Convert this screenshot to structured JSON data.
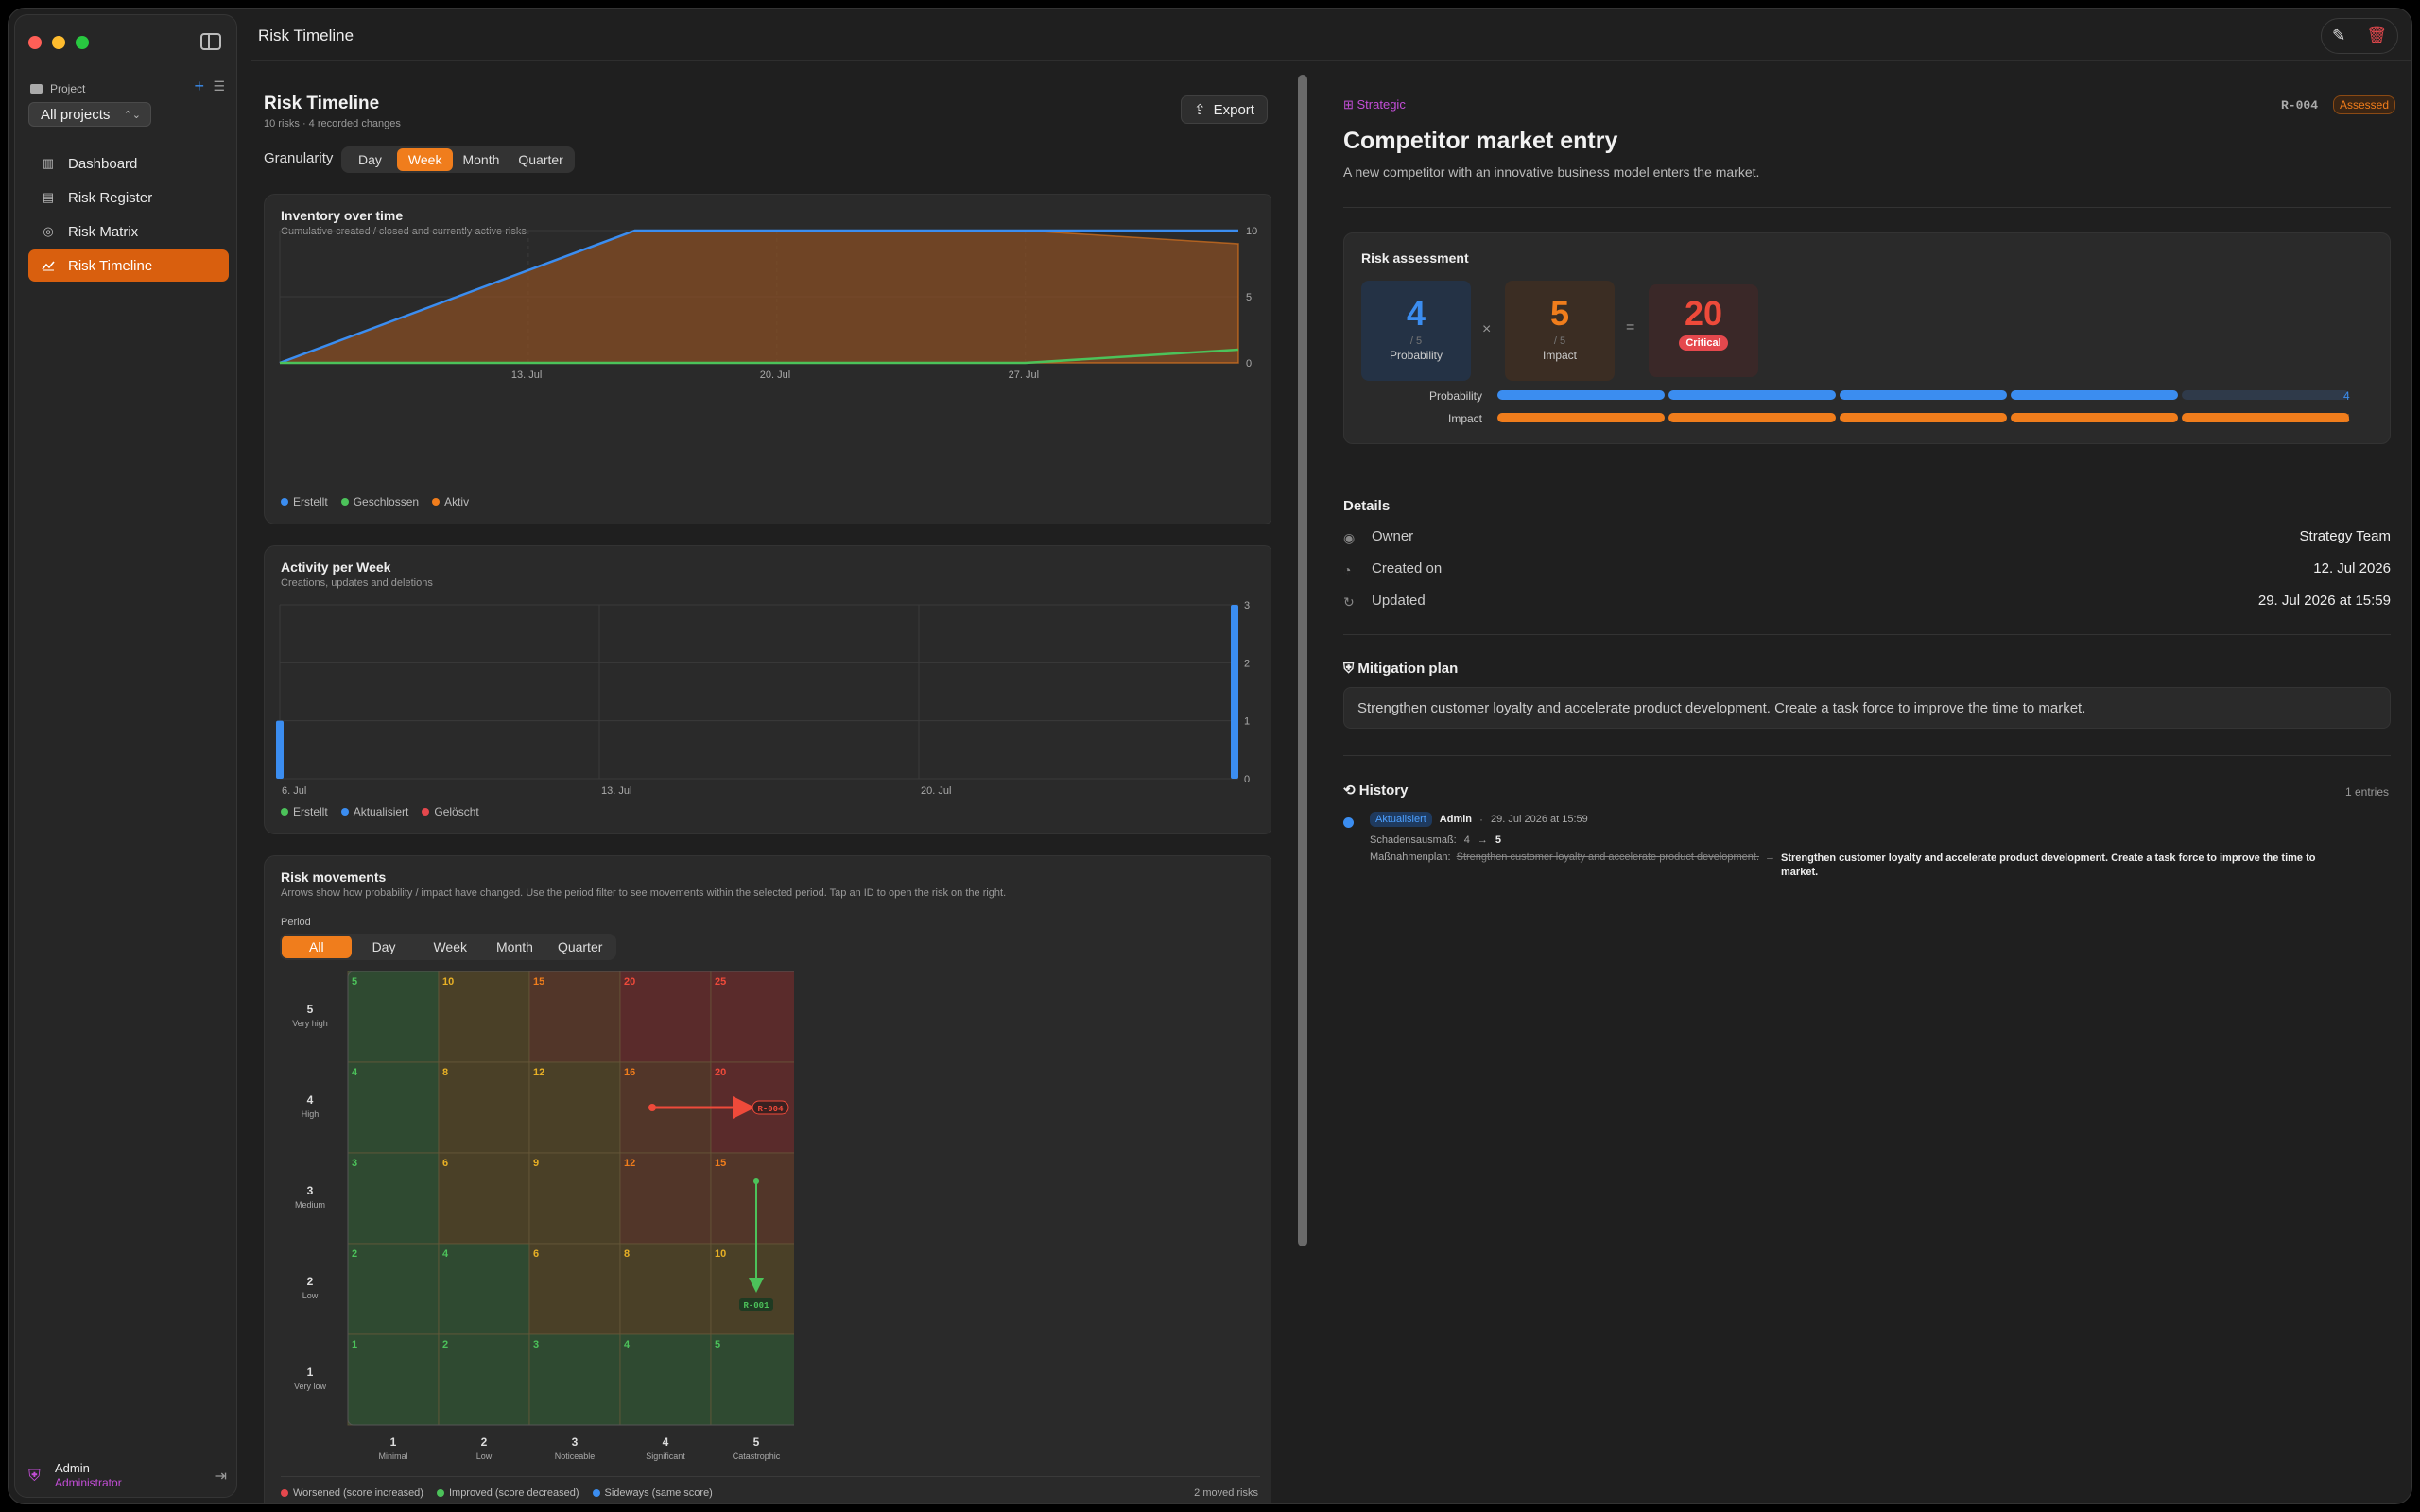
{
  "window": {
    "title": "Risk Timeline"
  },
  "sidebar": {
    "project_label": "Project",
    "project_select": "All projects",
    "items": [
      {
        "label": "Dashboard",
        "icon": "chart-bars-icon",
        "active": false
      },
      {
        "label": "Risk Register",
        "icon": "clipboard-icon",
        "active": false
      },
      {
        "label": "Risk Matrix",
        "icon": "target-icon",
        "active": false
      },
      {
        "label": "Risk Timeline",
        "icon": "line-chart-icon",
        "active": true
      }
    ],
    "user": {
      "name": "Admin",
      "role": "Administrator"
    }
  },
  "main": {
    "title": "Risk Timeline",
    "subtitle": "10 risks · 4 recorded changes",
    "export_label": "Export",
    "granularity_label": "Granularity",
    "granularity": [
      "Day",
      "Week",
      "Month",
      "Quarter"
    ],
    "granularity_selected": "Week"
  },
  "inventory": {
    "title": "Inventory over time",
    "subtitle": "Cumulative created / closed and currently active risks",
    "legend": [
      "Erstellt",
      "Geschlossen",
      "Aktiv"
    ]
  },
  "activity": {
    "title": "Activity per Week",
    "subtitle": "Creations, updates and deletions",
    "legend": [
      "Erstellt",
      "Aktualisiert",
      "Gelöscht"
    ]
  },
  "chart_data": [
    {
      "type": "area",
      "title": "Inventory over time",
      "x_ticks": [
        "13. Jul",
        "20. Jul",
        "27. Jul"
      ],
      "y_ticks": [
        0,
        5,
        10
      ],
      "ylim": [
        0,
        10
      ],
      "series": [
        {
          "name": "Erstellt",
          "color": "#3b8df0",
          "points": [
            [
              "06. Jul",
              0
            ],
            [
              "13. Jul",
              4.6
            ],
            [
              "13. Jul+3d",
              10
            ],
            [
              "02. Aug",
              10
            ]
          ]
        },
        {
          "name": "Geschlossen",
          "color": "#4cc25a",
          "points": [
            [
              "06. Jul",
              0
            ],
            [
              "27. Jul",
              0
            ],
            [
              "02. Aug",
              1
            ]
          ]
        },
        {
          "name": "Aktiv",
          "color": "#f07d1c",
          "points": [
            [
              "06. Jul",
              0
            ],
            [
              "16. Jul",
              10
            ],
            [
              "27. Jul",
              10
            ],
            [
              "02. Aug",
              9
            ]
          ]
        }
      ]
    },
    {
      "type": "bar",
      "title": "Activity per Week",
      "x_ticks": [
        "6. Jul",
        "13. Jul",
        "20. Jul"
      ],
      "y_ticks": [
        0,
        1,
        2,
        3
      ],
      "ylim": [
        0,
        3
      ],
      "series": [
        {
          "name": "Erstellt",
          "color": "#4cc25a",
          "values": [
            0,
            0,
            0,
            0
          ]
        },
        {
          "name": "Aktualisiert",
          "color": "#3b8df0",
          "values": [
            1,
            0,
            0,
            3
          ]
        },
        {
          "name": "Gelöscht",
          "color": "#e5484d",
          "values": [
            0,
            0,
            0,
            0
          ]
        }
      ]
    }
  ],
  "movements": {
    "title": "Risk movements",
    "subtitle": "Arrows show how probability / impact have changed. Use the period filter to see movements within the selected period. Tap an ID to open the risk on the right.",
    "period_label": "Period",
    "periods": [
      "All",
      "Day",
      "Week",
      "Month",
      "Quarter"
    ],
    "period_selected": "All",
    "y_labels": [
      {
        "n": "5",
        "t": "Very high"
      },
      {
        "n": "4",
        "t": "High"
      },
      {
        "n": "3",
        "t": "Medium"
      },
      {
        "n": "2",
        "t": "Low"
      },
      {
        "n": "1",
        "t": "Very low"
      }
    ],
    "x_labels": [
      {
        "n": "1",
        "t": "Minimal"
      },
      {
        "n": "2",
        "t": "Low"
      },
      {
        "n": "3",
        "t": "Noticeable"
      },
      {
        "n": "4",
        "t": "Significant"
      },
      {
        "n": "5",
        "t": "Catastrophic"
      }
    ],
    "moves": [
      {
        "id": "R-004",
        "from": [
          4,
          4
        ],
        "to": [
          4,
          5
        ],
        "kind": "worsened"
      },
      {
        "id": "R-001",
        "from": [
          3,
          5
        ],
        "to": [
          2,
          5
        ],
        "kind": "improved"
      }
    ],
    "legend": [
      "Worsened (score increased)",
      "Improved (score decreased)",
      "Sideways (same score)"
    ],
    "count": "2 moved risks"
  },
  "detail": {
    "category": "Strategic",
    "id": "R-004",
    "status": "Assessed",
    "title": "Competitor market entry",
    "description": "A new competitor with an innovative business model enters the market.",
    "assessment": {
      "title": "Risk assessment",
      "probability": "4",
      "impact": "5",
      "score": "20",
      "out_of": "/ 5",
      "probability_label": "Probability",
      "impact_label": "Impact",
      "level": "Critical",
      "times": "×",
      "equals": "="
    },
    "details_title": "Details",
    "owner_label": "Owner",
    "owner": "Strategy Team",
    "created_label": "Created on",
    "created": "12. Jul 2026",
    "updated_label": "Updated",
    "updated": "29. Jul 2026 at 15:59",
    "mitigation_title": "Mitigation plan",
    "mitigation": "Strengthen customer loyalty and accelerate product development. Create a task force to improve the time to market.",
    "history_title": "History",
    "history_count": "1 entries",
    "history": [
      {
        "badge": "Aktualisiert",
        "user": "Admin",
        "time": "29. Jul 2026 at 15:59",
        "c1_label": "Schadensausmaß:",
        "c1_old": "4",
        "c1_new": "5",
        "c2_label": "Maßnahmenplan:",
        "c2_old": "Strengthen customer loyalty and accelerate product development.",
        "c2_new": "Strengthen customer loyalty and accelerate product development. Create a task force to improve the time to market."
      }
    ]
  },
  "colors": {
    "accent": "#f07d1c",
    "blue": "#3b8df0",
    "green": "#4cc25a",
    "red": "#e5484d",
    "purple": "#c44ed8"
  }
}
